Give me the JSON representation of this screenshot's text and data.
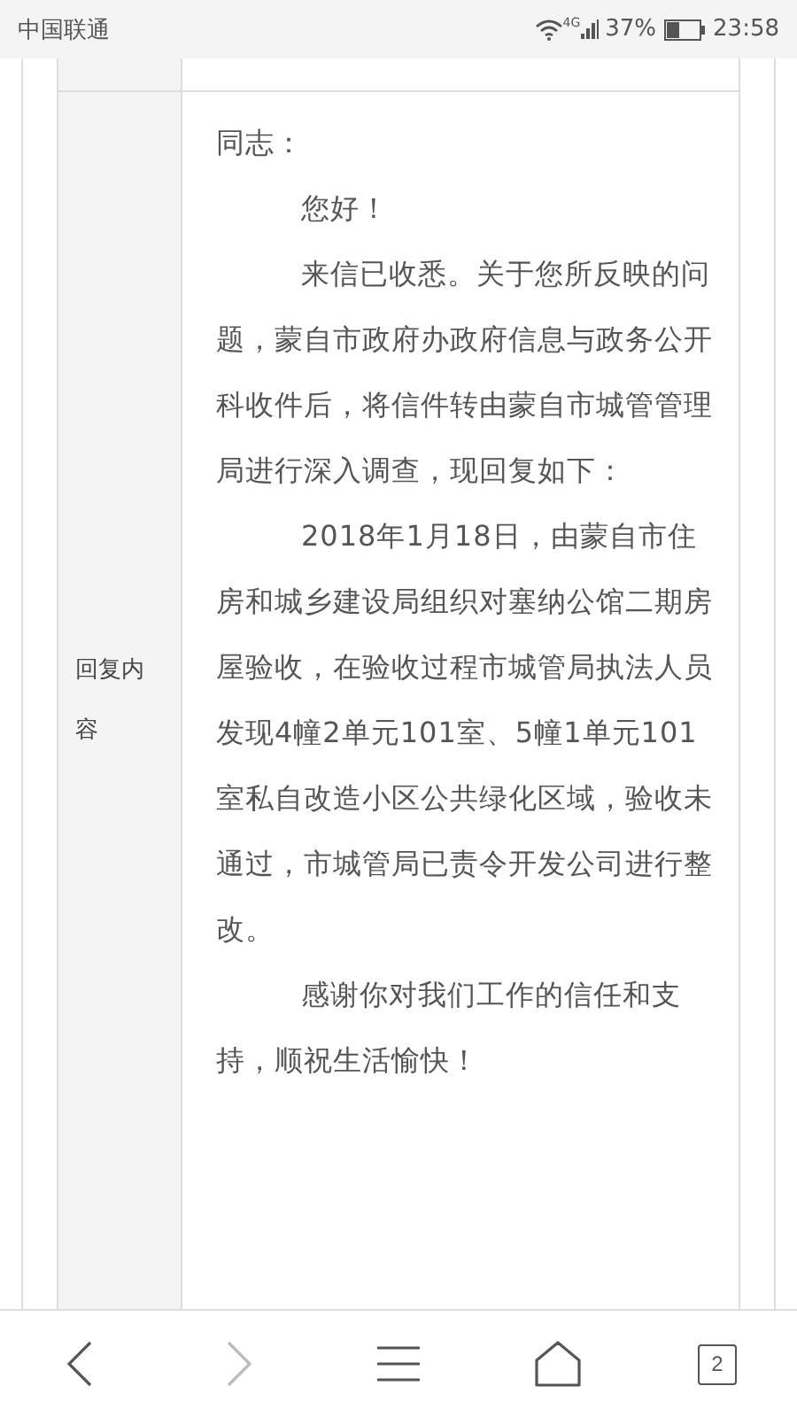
{
  "status_bar": {
    "carrier": "中国联通",
    "network": "4G",
    "battery": "37%",
    "time": "23:58"
  },
  "reply": {
    "label": "回复内容",
    "paragraphs": [
      {
        "indented": false,
        "text": "同志："
      },
      {
        "indented": true,
        "text": "您好！"
      },
      {
        "indented": true,
        "text": "来信已收悉。关于您所反映的问题，蒙自市政府办政府信息与政务公开科收件后，将信件转由蒙自市城管管理局进行深入调查，现回复如下："
      },
      {
        "indented": true,
        "text": "2018年1月18日，由蒙自市住房和城乡建设局组织对塞纳公馆二期房屋验收，在验收过程市城管局执法人员发现4幢2单元101室、5幢1单元101室私自改造小区公共绿化区域，验收未通过，市城管局已责令开发公司进行整改。"
      },
      {
        "indented": true,
        "text": "感谢你对我们工作的信任和支持，顺祝生活愉快！"
      }
    ]
  },
  "nav": [
    {
      "kind": "back",
      "disabled": false
    },
    {
      "kind": "forward",
      "disabled": true
    },
    {
      "kind": "menu",
      "disabled": false
    },
    {
      "kind": "home",
      "disabled": false
    },
    {
      "kind": "tabs",
      "disabled": false,
      "label": "2"
    }
  ]
}
